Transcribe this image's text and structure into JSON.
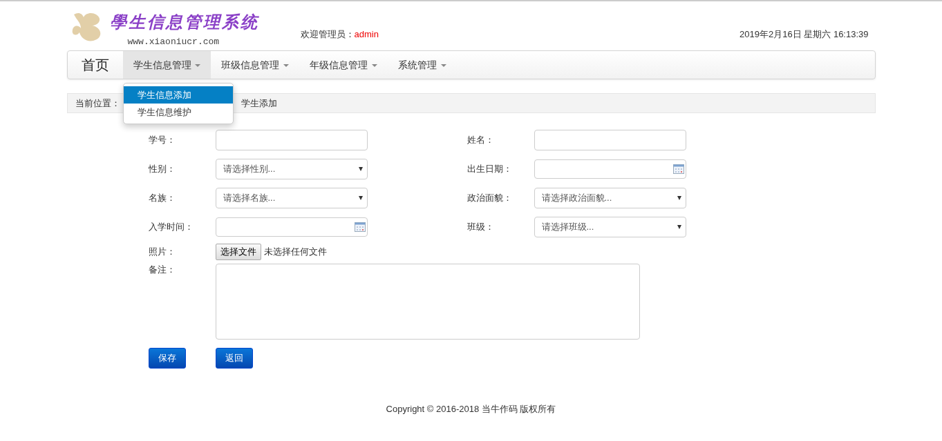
{
  "header": {
    "logo_title": "學生信息管理系统",
    "logo_url": "www.xiaoniucr.com",
    "welcome_label": "欢迎管理员：",
    "welcome_user": "admin",
    "datetime": "2019年2月16日 星期六 16:13:39"
  },
  "nav": {
    "home": "首页",
    "items": [
      {
        "label": "学生信息管理",
        "selected": true,
        "menu": [
          {
            "label": "学生信息添加",
            "selected": true
          },
          {
            "label": "学生信息维护",
            "selected": false
          }
        ]
      },
      {
        "label": "班级信息管理",
        "selected": false
      },
      {
        "label": "年级信息管理",
        "selected": false
      },
      {
        "label": "系统管理",
        "selected": false
      }
    ]
  },
  "breadcrumb": {
    "label": "当前位置：",
    "current": "学生添加"
  },
  "form": {
    "rows": [
      [
        {
          "label": "学号：",
          "kind": "text"
        },
        {
          "label": "姓名：",
          "kind": "text"
        }
      ],
      [
        {
          "label": "性别：",
          "kind": "select",
          "placeholder": "请选择性别..."
        },
        {
          "label": "出生日期：",
          "kind": "date"
        }
      ],
      [
        {
          "label": "名族：",
          "kind": "select",
          "placeholder": "请选择名族..."
        },
        {
          "label": "政治面貌：",
          "kind": "select",
          "placeholder": "请选择政治面貌..."
        }
      ],
      [
        {
          "label": "入学时间：",
          "kind": "date"
        },
        {
          "label": "班级：",
          "kind": "select",
          "placeholder": "请选择班级..."
        }
      ]
    ],
    "photo": {
      "label": "照片：",
      "button": "选择文件",
      "status": "未选择任何文件"
    },
    "remark": {
      "label": "备注："
    },
    "buttons": [
      "保存",
      "返回"
    ]
  },
  "footer": "Copyright © 2016-2018 当牛作码 版权所有"
}
